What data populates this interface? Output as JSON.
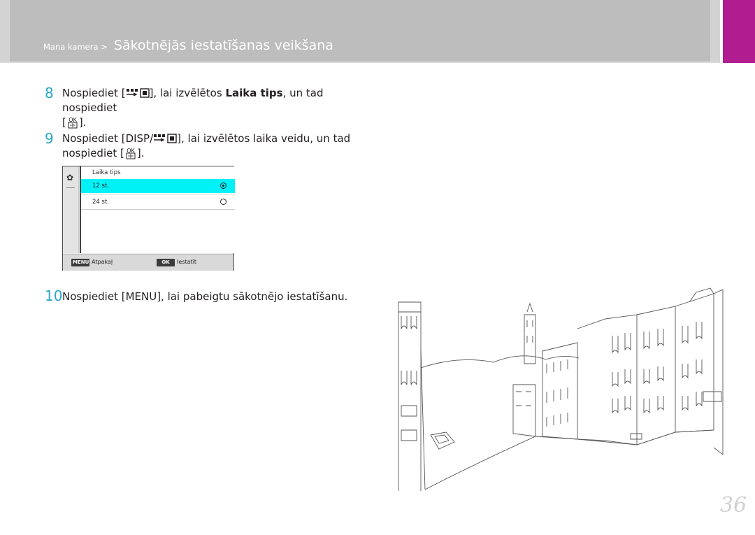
{
  "header": {
    "breadcrumb_parent": "Mana kamera >",
    "title": "Sākotnējās iestatīšanas veikšana",
    "accent_color": "#b11d8e"
  },
  "steps": [
    {
      "number": "8",
      "parts": [
        "Nospiediet [",
        "], lai izvēlētos ",
        "Laika tips",
        ", un tad nospiediet",
        "["
      ],
      "end": "]."
    },
    {
      "number": "9",
      "parts": [
        "Nospiediet [",
        "DISP",
        "/",
        "], lai izvēlētos laika veidu, un tad",
        "nospiediet ["
      ],
      "end": "]."
    },
    {
      "number": "10",
      "parts": [
        "Nospiediet [",
        "MENU",
        "], lai pabeigtu sākotnējo iestatīšanu."
      ]
    }
  ],
  "camera_screen": {
    "menu_title": "Laika tips",
    "options": [
      {
        "label": "12 st.",
        "selected": true
      },
      {
        "label": "24 st.",
        "selected": false
      }
    ],
    "highlight_color": "#00f2f6",
    "footer": {
      "menu_key": "MENU",
      "back_label": "Atpakaļ",
      "ok_key": "OK",
      "set_label": "Iestatīt"
    },
    "side_icon": "gear-icon"
  },
  "page_number": "36"
}
